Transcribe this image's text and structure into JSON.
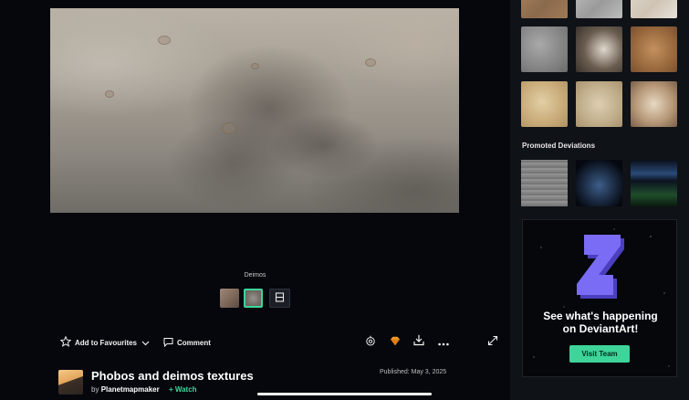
{
  "viewer": {
    "image_title": "Deimos"
  },
  "actions": {
    "favourite_label": "Add to Favourites",
    "comment_label": "Comment"
  },
  "deviation": {
    "title": "Phobos and deimos textures",
    "by_prefix": "by",
    "author": "Planetmapmaker",
    "watch_label": "+ Watch",
    "published": "Published: May 3, 2025"
  },
  "sidebar": {
    "promoted_heading": "Promoted Deviations",
    "promo_headline_line1": "See what's happening",
    "promo_headline_line2": "on DeviantArt!",
    "promo_button": "Visit Team"
  },
  "colors": {
    "accent": "#3ed49a",
    "background": "#06070d",
    "sidebar": "#0f1217",
    "logo": "#7b6cf6"
  },
  "icons": {
    "favourite": "star-outline-icon",
    "dropdown": "chevron-down-icon",
    "comment": "speech-bubble-icon",
    "badge": "badge-icon",
    "points": "gem-icon",
    "download": "download-icon",
    "more": "more-dots-icon",
    "expand": "expand-icon",
    "filmstrip": "filmstrip-icon"
  }
}
